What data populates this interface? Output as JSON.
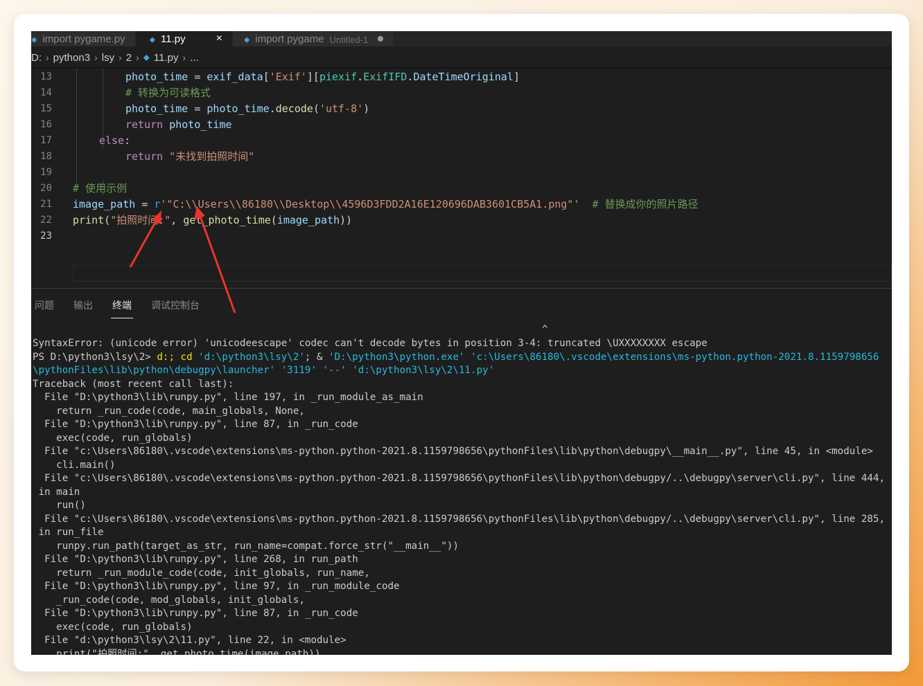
{
  "tabs": [
    {
      "label": "import pygame.py",
      "active": false
    },
    {
      "label": "11.py",
      "active": true,
      "close": "×"
    },
    {
      "label": "import pygame",
      "sub": "Untitled-1",
      "active": false,
      "dirty": true
    }
  ],
  "breadcrumb": [
    "D:",
    "python3",
    "lsy",
    "2",
    "11.py",
    "..."
  ],
  "editor": {
    "line_numbers": [
      "13",
      "14",
      "15",
      "16",
      "17",
      "18",
      "19",
      "20",
      "21",
      "22",
      "23"
    ],
    "lines": {
      "l13": {
        "a": "photo_time",
        "b": " = ",
        "c": "exif_data",
        "d": "[",
        "e": "'Exif'",
        "f": "][",
        "g": "piexif",
        "h": ".",
        "i": "ExifIFD",
        "j": ".",
        "k": "DateTimeOriginal",
        "l": "]"
      },
      "l14": "# 转换为可读格式",
      "l15": {
        "a": "photo_time",
        "b": " = ",
        "c": "photo_time",
        "d": ".",
        "e": "decode",
        "f": "(",
        "g": "'utf-8'",
        "h": ")"
      },
      "l16": {
        "a": "return",
        "b": " ",
        "c": "photo_time"
      },
      "l17": {
        "a": "else",
        "b": ":"
      },
      "l18": {
        "a": "return",
        "b": " ",
        "c": "\"未找到拍照时间\""
      },
      "l20": "# 使用示例",
      "l21": {
        "a": "image_path",
        "b": " = ",
        "c": "r",
        "d": "'\"C:\\\\Users\\\\86180\\\\Desktop\\\\4596D3FDD2A16E120696DAB3601CB5A1.png\"'",
        "e": "  ",
        "f": "# 替换成你的照片路径"
      },
      "l22": {
        "a": "print",
        "b": "(",
        "c": "\"拍照时间:\"",
        "d": ", ",
        "e": "get_photo_time",
        "f": "(",
        "g": "image_path",
        "h": "))"
      }
    }
  },
  "panel_tabs": [
    {
      "label": "问题",
      "active": false
    },
    {
      "label": "输出",
      "active": false
    },
    {
      "label": "终端",
      "active": true
    },
    {
      "label": "调试控制台",
      "active": false
    }
  ],
  "terminal": {
    "caret": "^",
    "error": "SyntaxError: (unicode error) 'unicodeescape' codec can't decode bytes in position 3-4: truncated \\UXXXXXXXX escape",
    "ps_prompt": "PS D:\\python3\\lsy\\2> ",
    "ps_cmd1": "d:; cd ",
    "ps_arg1": "'d:\\python3\\lsy\\2'",
    "ps_amp": "; & ",
    "ps_arg2": "'D:\\python3\\python.exe' 'c:\\Users\\86180\\.vscode\\extensions\\ms-python.python-2021.8.1159798656",
    "ps_cont": "\\pythonFiles\\lib\\python\\debugpy\\launcher' '3119' '--' 'd:\\python3\\lsy\\2\\11.py'",
    "trace": [
      "Traceback (most recent call last):",
      "  File \"D:\\python3\\lib\\runpy.py\", line 197, in _run_module_as_main",
      "    return _run_code(code, main_globals, None,",
      "  File \"D:\\python3\\lib\\runpy.py\", line 87, in _run_code",
      "    exec(code, run_globals)",
      "  File \"c:\\Users\\86180\\.vscode\\extensions\\ms-python.python-2021.8.1159798656\\pythonFiles\\lib\\python\\debugpy\\__main__.py\", line 45, in <module>",
      "    cli.main()",
      "  File \"c:\\Users\\86180\\.vscode\\extensions\\ms-python.python-2021.8.1159798656\\pythonFiles\\lib\\python\\debugpy/..\\debugpy\\server\\cli.py\", line 444,",
      " in main",
      "    run()",
      "  File \"c:\\Users\\86180\\.vscode\\extensions\\ms-python.python-2021.8.1159798656\\pythonFiles\\lib\\python\\debugpy/..\\debugpy\\server\\cli.py\", line 285,",
      " in run_file",
      "    runpy.run_path(target_as_str, run_name=compat.force_str(\"__main__\"))",
      "  File \"D:\\python3\\lib\\runpy.py\", line 268, in run_path",
      "    return _run_module_code(code, init_globals, run_name,",
      "  File \"D:\\python3\\lib\\runpy.py\", line 97, in _run_module_code",
      "    _run_code(code, mod_globals, init_globals,",
      "  File \"D:\\python3\\lib\\runpy.py\", line 87, in _run_code",
      "    exec(code, run_globals)",
      "  File \"d:\\python3\\lsy\\2\\11.py\", line 22, in <module>",
      "    print(\"拍照时间:\", get_photo_time(image_path))"
    ]
  },
  "colors": {
    "arrow": "#e8352b",
    "editor_bg": "#1e1e1e",
    "accent": "#f29a3a"
  }
}
